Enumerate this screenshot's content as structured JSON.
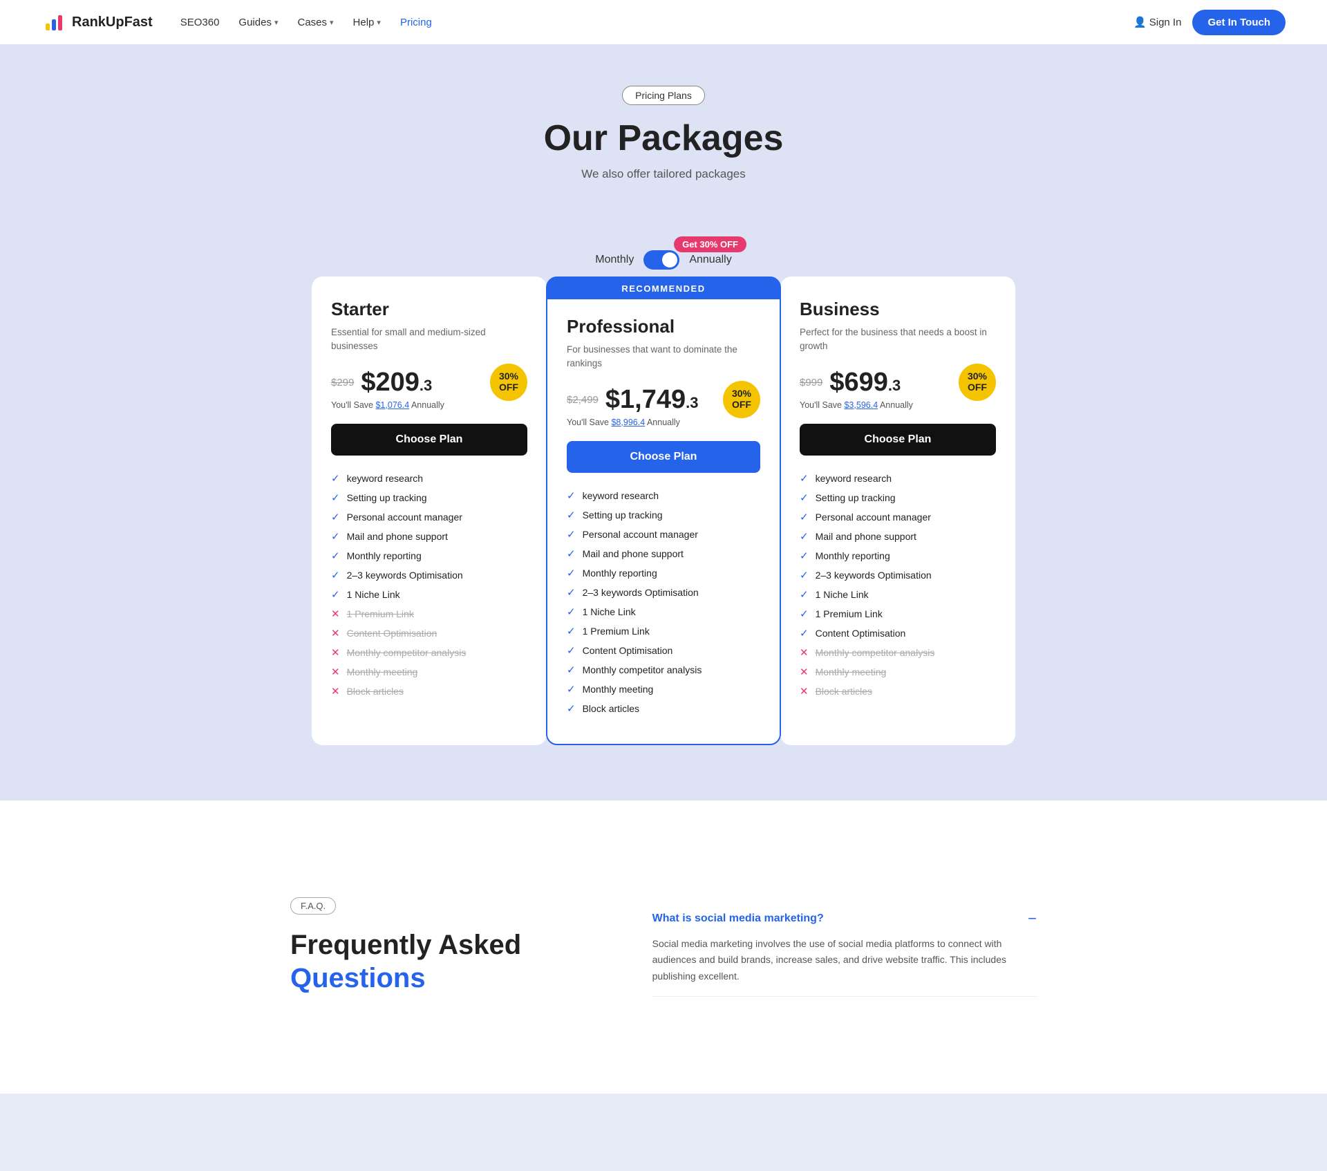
{
  "nav": {
    "logo_text": "RankUpFast",
    "links": [
      {
        "label": "SEO360",
        "has_dropdown": false
      },
      {
        "label": "Guides",
        "has_dropdown": true
      },
      {
        "label": "Cases",
        "has_dropdown": true
      },
      {
        "label": "Help",
        "has_dropdown": true
      },
      {
        "label": "Pricing",
        "has_dropdown": false,
        "active": true
      }
    ],
    "sign_in": "Sign In",
    "get_in_touch": "Get In Touch"
  },
  "hero": {
    "badge": "Pricing Plans",
    "title": "Our Packages",
    "subtitle": "We also offer tailored packages"
  },
  "toggle": {
    "monthly_label": "Monthly",
    "annually_label": "Annually",
    "discount_badge": "Get 30% OFF"
  },
  "plans": [
    {
      "id": "starter",
      "name": "Starter",
      "desc": "Essential for small and medium-sized businesses",
      "old_price": "$299",
      "new_price": "$209",
      "new_price_decimal": ".3",
      "off": "30%\nOFF",
      "save_text": "You'll Save",
      "save_amount": "$1,076.4",
      "save_period": "Annually",
      "btn_label": "Choose Plan",
      "btn_type": "dark",
      "recommended": false,
      "features": [
        {
          "label": "keyword research",
          "included": true,
          "strikethrough": false
        },
        {
          "label": "Setting up tracking",
          "included": true,
          "strikethrough": false
        },
        {
          "label": "Personal account manager",
          "included": true,
          "strikethrough": false
        },
        {
          "label": "Mail and phone support",
          "included": true,
          "strikethrough": false
        },
        {
          "label": "Monthly reporting",
          "included": true,
          "strikethrough": false
        },
        {
          "label": "2–3 keywords Optimisation",
          "included": true,
          "strikethrough": false
        },
        {
          "label": "1 Niche Link",
          "included": true,
          "strikethrough": false
        },
        {
          "label": "1 Premium Link",
          "included": false,
          "strikethrough": true
        },
        {
          "label": "Content Optimisation",
          "included": false,
          "strikethrough": true
        },
        {
          "label": "Monthly competitor analysis",
          "included": false,
          "strikethrough": true
        },
        {
          "label": "Monthly meeting",
          "included": false,
          "strikethrough": true
        },
        {
          "label": "Block articles",
          "included": false,
          "strikethrough": true
        }
      ]
    },
    {
      "id": "professional",
      "name": "Professional",
      "desc": "For businesses that want to dominate the rankings",
      "old_price": "$2,499",
      "new_price": "$1,749",
      "new_price_decimal": ".3",
      "off": "30%\nOFF",
      "save_text": "You'll Save",
      "save_amount": "$8,996.4",
      "save_period": "Annually",
      "btn_label": "Choose Plan",
      "btn_type": "blue",
      "recommended": true,
      "features": [
        {
          "label": "keyword research",
          "included": true,
          "strikethrough": false
        },
        {
          "label": "Setting up tracking",
          "included": true,
          "strikethrough": false
        },
        {
          "label": "Personal account manager",
          "included": true,
          "strikethrough": false
        },
        {
          "label": "Mail and phone support",
          "included": true,
          "strikethrough": false
        },
        {
          "label": "Monthly reporting",
          "included": true,
          "strikethrough": false
        },
        {
          "label": "2–3 keywords Optimisation",
          "included": true,
          "strikethrough": false
        },
        {
          "label": "1 Niche Link",
          "included": true,
          "strikethrough": false
        },
        {
          "label": "1 Premium Link",
          "included": true,
          "strikethrough": false
        },
        {
          "label": "Content Optimisation",
          "included": true,
          "strikethrough": false
        },
        {
          "label": "Monthly competitor analysis",
          "included": true,
          "strikethrough": false
        },
        {
          "label": "Monthly meeting",
          "included": true,
          "strikethrough": false
        },
        {
          "label": "Block articles",
          "included": true,
          "strikethrough": false
        }
      ]
    },
    {
      "id": "business",
      "name": "Business",
      "desc": "Perfect for the business that needs a boost in growth",
      "old_price": "$999",
      "new_price": "$699",
      "new_price_decimal": ".3",
      "off": "30%\nOFF",
      "save_text": "You'll Save",
      "save_amount": "$3,596.4",
      "save_period": "Annually",
      "btn_label": "Choose Plan",
      "btn_type": "dark",
      "recommended": false,
      "features": [
        {
          "label": "keyword research",
          "included": true,
          "strikethrough": false
        },
        {
          "label": "Setting up tracking",
          "included": true,
          "strikethrough": false
        },
        {
          "label": "Personal account manager",
          "included": true,
          "strikethrough": false
        },
        {
          "label": "Mail and phone support",
          "included": true,
          "strikethrough": false
        },
        {
          "label": "Monthly reporting",
          "included": true,
          "strikethrough": false
        },
        {
          "label": "2–3 keywords Optimisation",
          "included": true,
          "strikethrough": false
        },
        {
          "label": "1 Niche Link",
          "included": true,
          "strikethrough": false
        },
        {
          "label": "1 Premium Link",
          "included": true,
          "strikethrough": false
        },
        {
          "label": "Content Optimisation",
          "included": true,
          "strikethrough": false
        },
        {
          "label": "Monthly competitor analysis",
          "included": false,
          "strikethrough": true
        },
        {
          "label": "Monthly meeting",
          "included": false,
          "strikethrough": true
        },
        {
          "label": "Block articles",
          "included": false,
          "strikethrough": true
        }
      ]
    }
  ],
  "faq": {
    "badge": "F.A.Q.",
    "title_line1": "Frequently Asked",
    "title_line2": "Questions",
    "items": [
      {
        "question": "What is social media marketing?",
        "answer": "Social media marketing involves the use of social media platforms to connect with audiences and build brands, increase sales, and drive website traffic. This includes publishing excellent.",
        "open": true
      }
    ]
  }
}
